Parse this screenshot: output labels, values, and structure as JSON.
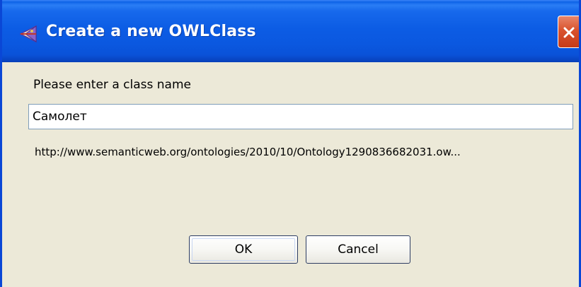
{
  "window": {
    "title": "Create a new OWLClass",
    "title_icon": "protege-owl-icon",
    "close_icon": "close-icon"
  },
  "dialog": {
    "prompt_label": "Please enter a class name",
    "class_name_value": "Самолет",
    "iri_preview": "http://www.semanticweb.org/ontologies/2010/10/Ontology1290836682031.ow..."
  },
  "buttons": {
    "ok_label": "OK",
    "cancel_label": "Cancel"
  },
  "colors": {
    "titlebar_blue": "#0a5fe6",
    "dialog_background": "#ece9d8",
    "close_button_red": "#d9532e"
  }
}
